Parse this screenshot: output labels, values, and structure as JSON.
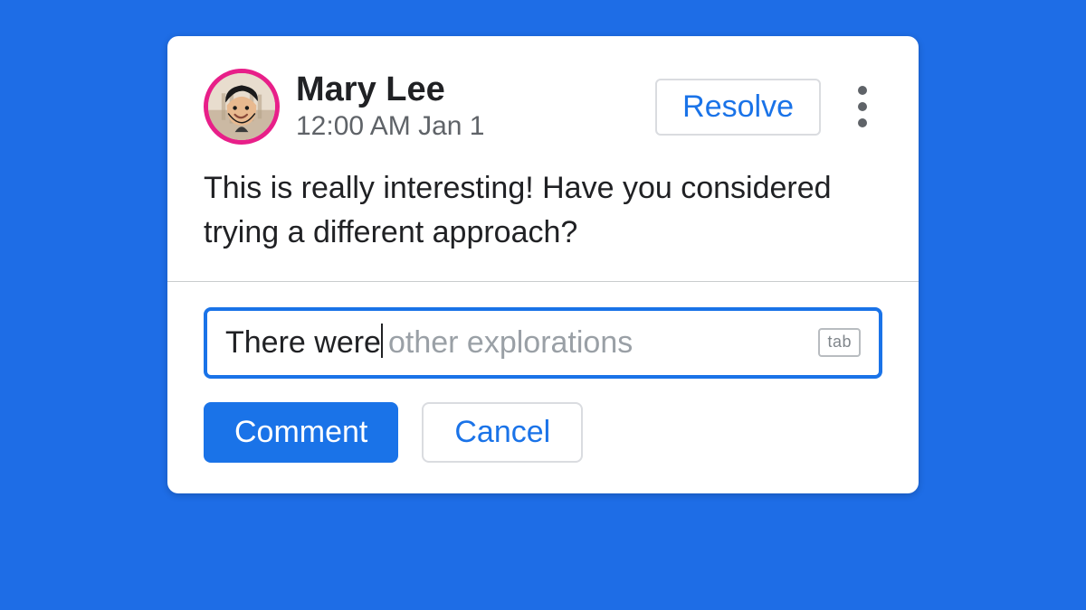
{
  "comment": {
    "author": "Mary Lee",
    "timestamp": "12:00 AM Jan 1",
    "body": "This is really interesting! Have you considered trying a different approach?"
  },
  "actions": {
    "resolve_label": "Resolve",
    "comment_label": "Comment",
    "cancel_label": "Cancel"
  },
  "reply": {
    "typed_text": "There were",
    "suggestion_text": "other explorations",
    "tab_hint": "tab"
  },
  "colors": {
    "accent": "#1a73e8",
    "avatar_ring": "#E81F89",
    "background": "#1E6DE6"
  }
}
